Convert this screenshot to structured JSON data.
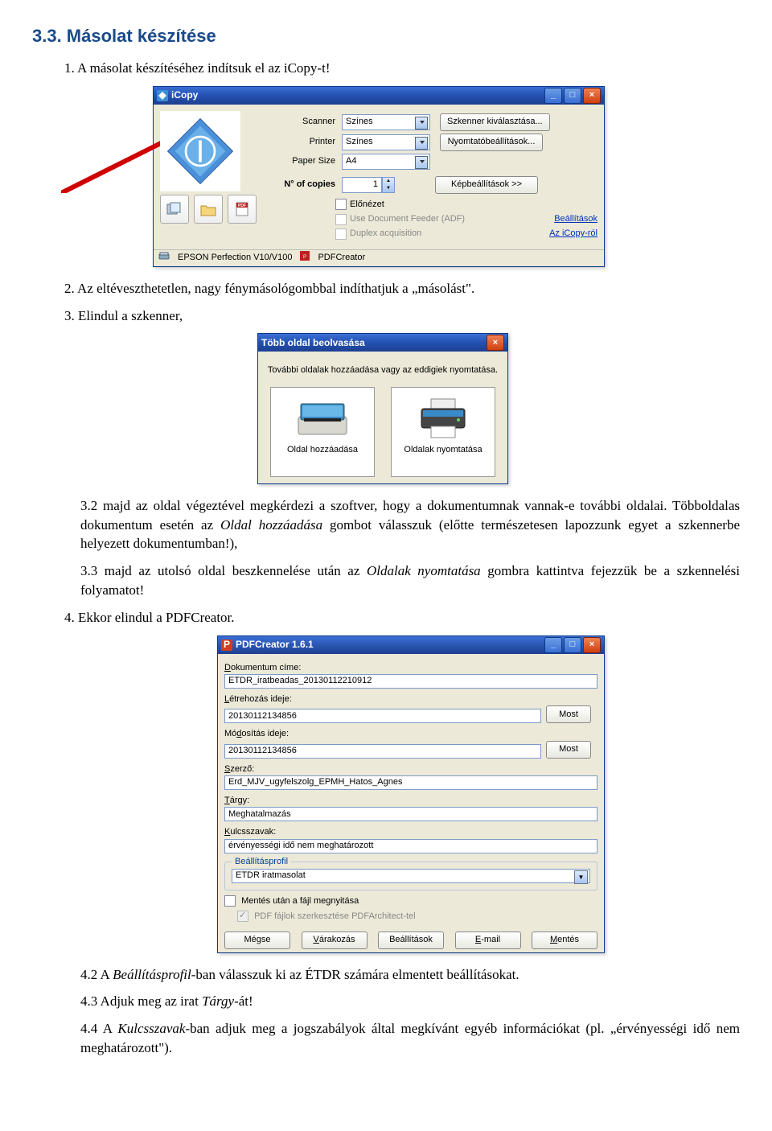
{
  "heading": "3.3.   Másolat készítése",
  "p1": "1. A másolat készítéséhez indítsuk el az iCopy-t!",
  "p2": "2. Az eltéveszthetetlen, nagy fénymásológombbal indíthatjuk a „másolást\".",
  "p3": "3. Elindul a szkenner,",
  "p3_2": "3.2 majd az oldal végeztével megkérdezi a szoftver, hogy a dokumentumnak vannak-e további oldalai. Többoldalas dokumentum esetén az ",
  "p3_2_i": "Oldal hozzáadása",
  "p3_2b": " gombot válasszuk (előtte természetesen lapozzunk egyet a szkennerbe helyezett dokumentumban!),",
  "p3_3": "3.3 majd az utolsó oldal beszkennelése után az ",
  "p3_3_i": "Oldalak nyomtatása",
  "p3_3b": " gombra kattintva fejezzük be a szkennelési folyamatot!",
  "p4": "4. Ekkor elindul a PDFCreator.",
  "p4_2a": "4.2 A ",
  "p4_2_i": "Beállításprofil",
  "p4_2b": "-ban válasszuk ki az ÉTDR számára elmentett beállításokat.",
  "p4_3a": "4.3 Adjuk meg az irat ",
  "p4_3_i": "Tárgy",
  "p4_3b": "-át!",
  "p4_4a": "4.4 A ",
  "p4_4_i": "Kulcsszavak",
  "p4_4b": "-ban adjuk meg a jogszabályok által megkívánt egyéb információkat (pl. „érvényességi idő nem meghatározott\").",
  "icopy": {
    "title": "iCopy",
    "labels": {
      "scanner": "Scanner",
      "printer": "Printer",
      "papersize": "Paper Size",
      "copies": "N° of copies"
    },
    "values": {
      "scanner": "Színes",
      "printer": "Színes",
      "papersize": "A4",
      "copies": "1"
    },
    "buttons": {
      "scanner_select": "Szkenner kiválasztása...",
      "printer_settings": "Nyomtatóbeállítások...",
      "img_settings": "Képbeállítások >>"
    },
    "preview": "Előnézet",
    "adf": "Use Document Feeder (ADF)",
    "duplex": "Duplex acquisition",
    "links": {
      "settings": "Beállítások",
      "about": "Az iCopy-ról"
    },
    "status_scanner": "EPSON Perfection V10/V100",
    "status_printer": "PDFCreator"
  },
  "scandlg": {
    "title": "Több oldal beolvasása",
    "msg": "További oldalak hozzáadása vagy az eddigiek nyomtatása.",
    "add": "Oldal hozzáadása",
    "print": "Oldalak nyomtatása"
  },
  "pdfc": {
    "title": "PDFCreator 1.6.1",
    "labels": {
      "doc_title": "Dokumentum címe:",
      "created": "Létrehozás ideje:",
      "modified": "Módosítás ideje:",
      "author": "Szerző:",
      "subject": "Tárgy:",
      "keywords": "Kulcsszavak:",
      "profile": "Beállításprofil",
      "open_after": "Mentés után a fájl megnyitása",
      "pdf_architect": "PDF fájlok szerkesztése PDFArchitect-tel"
    },
    "values": {
      "doc_title": "ETDR_iratbeadas_20130112210912",
      "created": "20130112134856",
      "modified": "20130112134856",
      "author": "Erd_MJV_ugyfelszolg_EPMH_Hatos_Agnes",
      "subject": "Meghatalmazás",
      "keywords": "érvényességi idő nem meghatározott",
      "profile": "ETDR iratmasolat"
    },
    "buttons": {
      "now": "Most",
      "cancel": "Mégse",
      "wait": "Várakozás",
      "settings": "Beállítások",
      "email": "E-mail",
      "save": "Mentés"
    }
  }
}
